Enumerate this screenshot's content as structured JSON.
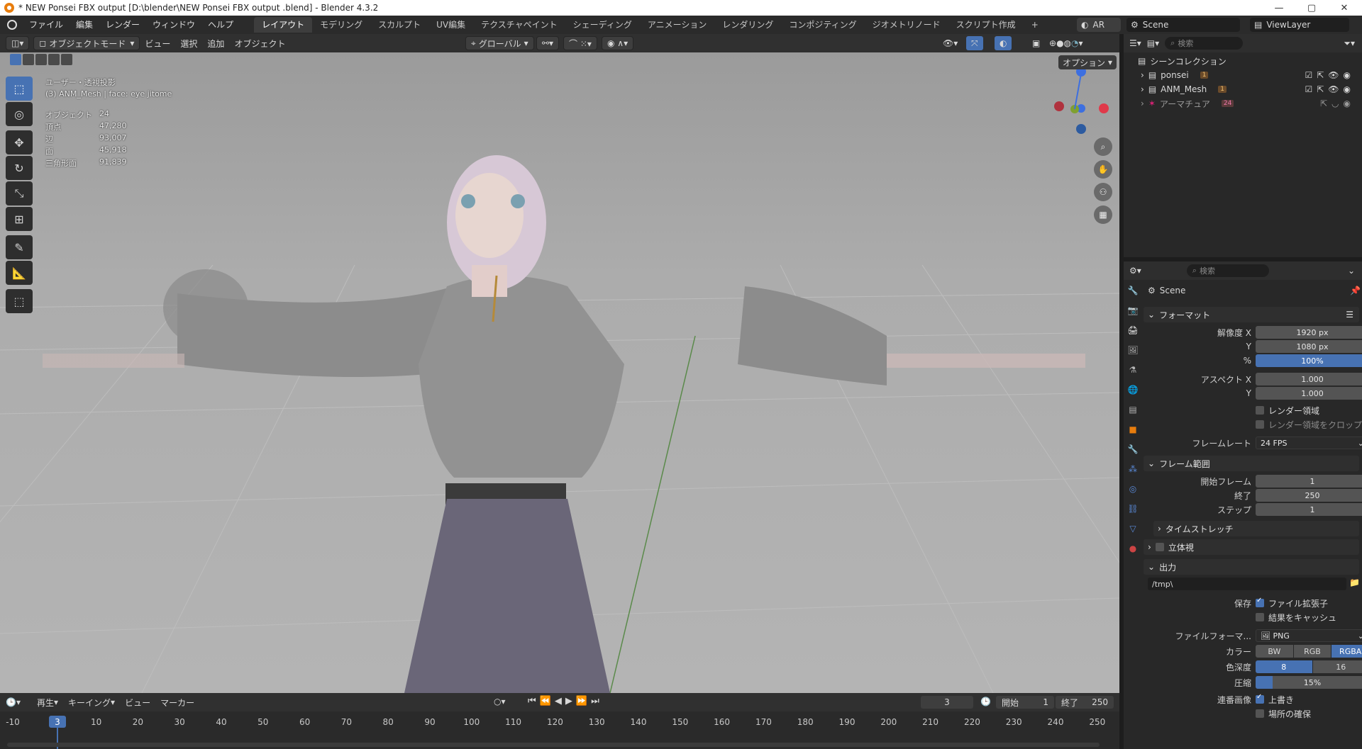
{
  "titlebar": {
    "title": "* NEW   Ponsei   FBX output  [D:\\blender\\NEW   Ponsei   FBX output .blend] - Blender 4.3.2",
    "minimize": "—",
    "maximize": "▢",
    "close": "✕"
  },
  "menu": [
    "ファイル",
    "編集",
    "レンダー",
    "ウィンドウ",
    "ヘルプ"
  ],
  "workspaces": [
    "レイアウト",
    "モデリング",
    "スカルプト",
    "UV編集",
    "テクスチャペイント",
    "シェーディング",
    "アニメーション",
    "レンダリング",
    "コンポジティング",
    "ジオメトリノード",
    "スクリプト作成"
  ],
  "workspace_add": "+",
  "scene": {
    "view_label": "AR",
    "scene_name": "Scene",
    "view_layer": "ViewLayer"
  },
  "viewport_header": {
    "mode": "オブジェクトモード",
    "view": "ビュー",
    "select": "選択",
    "add": "追加",
    "object": "オブジェクト",
    "transform": "グローバル",
    "options": "オプション"
  },
  "viewport_info": {
    "line1": "ユーザー・透視投影",
    "line2": "(3) ANM_Mesh | face: eye jitome"
  },
  "stats": [
    {
      "label": "オブジェクト",
      "value": "24"
    },
    {
      "label": "頂点",
      "value": "47,280"
    },
    {
      "label": "辺",
      "value": "93,007"
    },
    {
      "label": "面",
      "value": "45,918"
    },
    {
      "label": "三角形面",
      "value": "91,839"
    }
  ],
  "outliner": {
    "search_placeholder": "検索",
    "root": "シーンコレクション",
    "items": [
      {
        "name": "ponsei",
        "badge": "1"
      },
      {
        "name": "ANM_Mesh",
        "badge": "1"
      },
      {
        "name": "アーマチュア",
        "badge": "24"
      }
    ]
  },
  "properties": {
    "search_placeholder": "検索",
    "breadcrumb": "Scene",
    "format_header": "フォーマット",
    "res_x_label": "解像度 X",
    "res_x": "1920 px",
    "res_y_label": "Y",
    "res_y": "1080 px",
    "res_pct_label": "%",
    "res_pct": "100%",
    "aspect_x_label": "アスペクト X",
    "aspect_x": "1.000",
    "aspect_y_label": "Y",
    "aspect_y": "1.000",
    "render_region": "レンダー領域",
    "crop_region": "レンダー領域をクロップ",
    "framerate_label": "フレームレート",
    "framerate": "24 FPS",
    "frame_range_header": "フレーム範囲",
    "start_label": "開始フレーム",
    "start": "1",
    "end_label": "終了",
    "end": "250",
    "step_label": "ステップ",
    "step": "1",
    "time_stretch": "タイムストレッチ",
    "stereo": "立体視",
    "output_header": "出力",
    "output_path": "/tmp\\",
    "save_label": "保存",
    "file_ext": "ファイル拡張子",
    "cache": "結果をキャッシュ",
    "file_format_label": "ファイルフォーマ...",
    "file_format": "PNG",
    "color_label": "カラー",
    "color_opts": [
      "BW",
      "RGB",
      "RGBA"
    ],
    "depth_label": "色深度",
    "depth_opts": [
      "8",
      "16"
    ],
    "compress_label": "圧縮",
    "compress": "15%",
    "compress_level": 0.15,
    "sequence_label": "連番画像",
    "overwrite": "上書き",
    "placeholders": "場所の確保"
  },
  "timeline": {
    "play": "再生",
    "keying": "キーイング",
    "view": "ビュー",
    "marker": "マーカー",
    "current": "3",
    "start_label": "開始",
    "start": "1",
    "end_label": "終了",
    "end": "250",
    "ticks": [
      "-10",
      "0",
      "10",
      "20",
      "30",
      "40",
      "50",
      "60",
      "70",
      "80",
      "90",
      "100",
      "110",
      "120",
      "130",
      "140",
      "150",
      "160",
      "170",
      "180",
      "190",
      "200",
      "210",
      "220",
      "230",
      "240",
      "250"
    ],
    "playhead": "3"
  },
  "colors": {
    "accent": "#4772b3",
    "orange": "#e87d0d"
  }
}
